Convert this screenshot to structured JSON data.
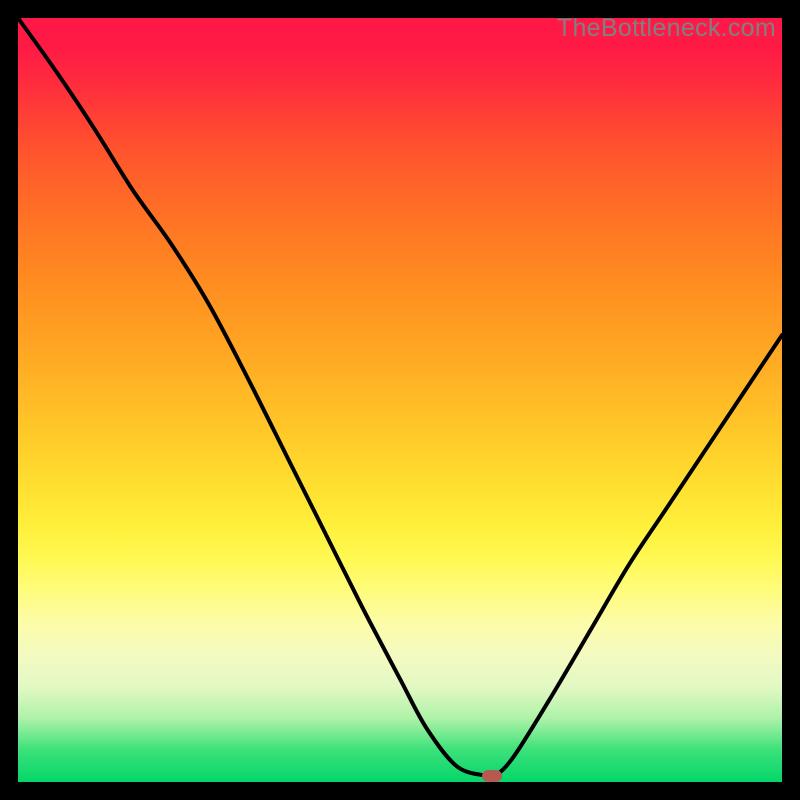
{
  "watermark": "TheBottleneck.com",
  "chart_data": {
    "type": "line",
    "title": "",
    "xlabel": "",
    "ylabel": "",
    "xlim": [
      0,
      100
    ],
    "ylim": [
      0,
      100
    ],
    "grid": false,
    "series": [
      {
        "name": "curve",
        "x": [
          0.0,
          5.0,
          10.0,
          15.0,
          20.0,
          25.0,
          30.0,
          35.0,
          40.0,
          45.0,
          50.0,
          53.5,
          57.5,
          61.5,
          62.5,
          65.0,
          70.0,
          75.0,
          80.0,
          85.0,
          90.0,
          95.0,
          100.0
        ],
        "y": [
          100.0,
          93.0,
          85.5,
          77.5,
          70.5,
          62.5,
          53.0,
          43.0,
          33.0,
          23.0,
          13.5,
          7.0,
          2.0,
          0.8,
          0.8,
          3.5,
          11.5,
          20.0,
          28.5,
          36.0,
          43.5,
          51.0,
          58.5
        ]
      }
    ],
    "marker": {
      "x": 62.0,
      "y": 0.8
    },
    "background_gradient": {
      "top": "#ff1748",
      "mid": "#ffbb26",
      "bottom": "#04d66a"
    }
  }
}
